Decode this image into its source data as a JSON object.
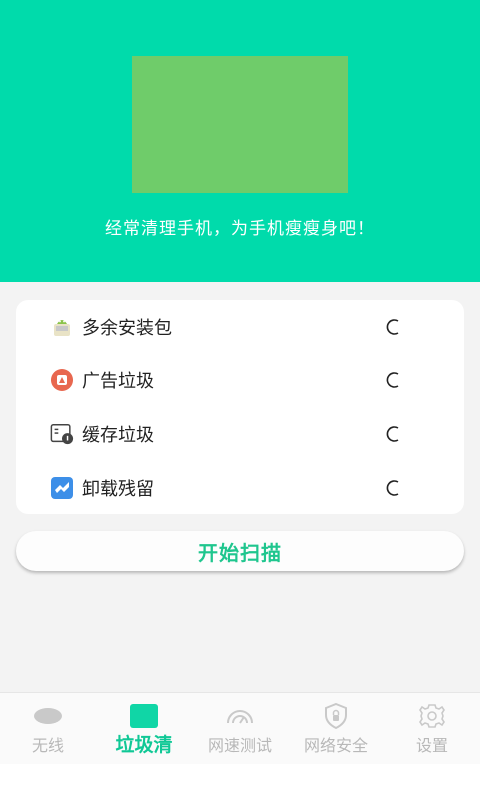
{
  "header": {
    "tagline": "经常清理手机，为手机瘦瘦身吧！",
    "background_color": "#00dbab",
    "image_placeholder_color": "#6fcc6a"
  },
  "clean_items": [
    {
      "label": "多余安装包",
      "icon": "apk-package-icon",
      "status_icon": "loading-spinner-icon"
    },
    {
      "label": "广告垃圾",
      "icon": "ad-junk-icon",
      "status_icon": "loading-spinner-icon"
    },
    {
      "label": "缓存垃圾",
      "icon": "cache-junk-icon",
      "status_icon": "loading-spinner-icon"
    },
    {
      "label": "卸载残留",
      "icon": "uninstall-residue-icon",
      "status_icon": "loading-spinner-icon"
    }
  ],
  "actions": {
    "start_scan_label": "开始扫描",
    "accent_color": "#1fc68e"
  },
  "bottom_nav": {
    "items": [
      {
        "label": "无线",
        "icon": "wifi-oval-icon",
        "active": false
      },
      {
        "label": "垃圾清",
        "icon": "junk-clean-icon",
        "active": true
      },
      {
        "label": "网速测试",
        "icon": "speed-gauge-icon",
        "active": false
      },
      {
        "label": "网络安全",
        "icon": "shield-icon",
        "active": false
      },
      {
        "label": "设置",
        "icon": "gear-icon",
        "active": false
      }
    ]
  }
}
